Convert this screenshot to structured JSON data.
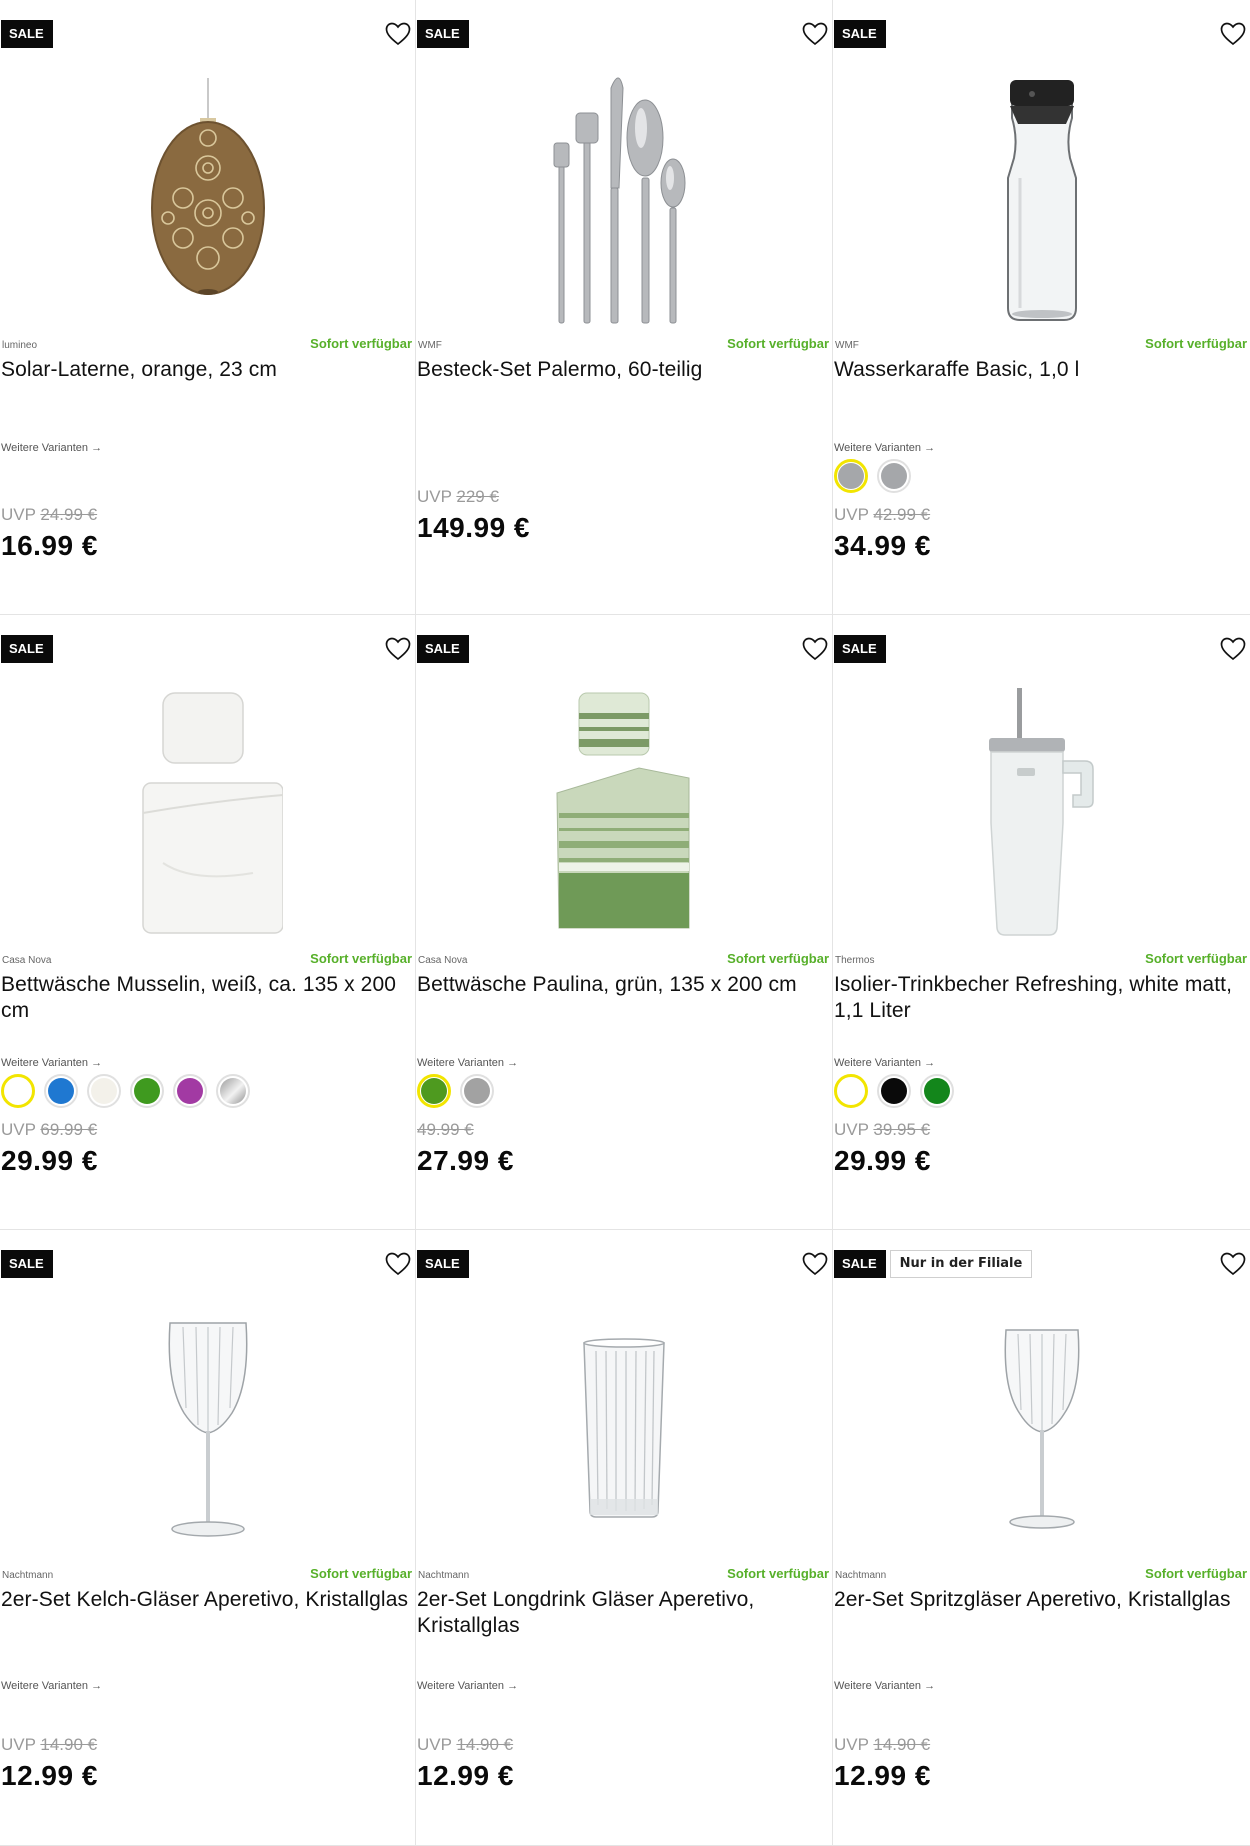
{
  "products": [
    {
      "sale_label": "SALE",
      "extra_badge": "",
      "brand": "lumineo",
      "availability": "Sofort verfügbar",
      "title": "Solar-Laterne, orange, 23 cm",
      "variants_label": "Weitere Varianten →",
      "uvp_label": "UVP",
      "old_price": "24.99 €",
      "price": "16.99 €",
      "swatches": []
    },
    {
      "sale_label": "SALE",
      "extra_badge": "",
      "brand": "WMF",
      "availability": "Sofort verfügbar",
      "title": "Besteck-Set Palermo, 60-teilig",
      "variants_label": "",
      "uvp_label": "UVP",
      "old_price": "229 €",
      "price": "149.99 €",
      "swatches": []
    },
    {
      "sale_label": "SALE",
      "extra_badge": "",
      "brand": "WMF",
      "availability": "Sofort verfügbar",
      "title": "Wasserkaraffe Basic, 1,0 l",
      "variants_label": "Weitere Varianten →",
      "uvp_label": "UVP",
      "old_price": "42.99 €",
      "price": "34.99 €",
      "swatches": [
        {
          "color": "#a5a7aa",
          "selected": true
        },
        {
          "color": "#a5a7aa",
          "selected": false
        }
      ]
    },
    {
      "sale_label": "SALE",
      "extra_badge": "",
      "brand": "Casa Nova",
      "availability": "Sofort verfügbar",
      "title": "Bettwäsche Musselin, weiß, ca. 135 x 200 cm",
      "variants_label": "Weitere Varianten →",
      "uvp_label": "UVP",
      "old_price": "69.99 €",
      "price": "29.99 €",
      "swatches": [
        {
          "color": "#ffffff",
          "selected": true
        },
        {
          "color": "#1f78d1",
          "selected": false
        },
        {
          "color": "#f3f1ea",
          "selected": false
        },
        {
          "color": "#3f9a1f",
          "selected": false
        },
        {
          "color": "#a23aa3",
          "selected": false
        },
        {
          "color": "linear-gradient(135deg,#9a9a9a,#f2f2f2 55%,#8f8f8f)",
          "selected": false
        }
      ]
    },
    {
      "sale_label": "SALE",
      "extra_badge": "",
      "brand": "Casa Nova",
      "availability": "Sofort verfügbar",
      "title": "Bettwäsche Paulina, grün, 135 x 200 cm",
      "variants_label": "Weitere Varianten →",
      "uvp_label": "",
      "old_price": "49.99 €",
      "price": "27.99 €",
      "swatches": [
        {
          "color": "#4e9a1f",
          "selected": true
        },
        {
          "color": "#a2a2a2",
          "selected": false
        }
      ]
    },
    {
      "sale_label": "SALE",
      "extra_badge": "",
      "brand": "Thermos",
      "availability": "Sofort verfügbar",
      "title": "Isolier-Trinkbecher Refreshing, white matt, 1,1 Liter",
      "variants_label": "Weitere Varianten →",
      "uvp_label": "UVP",
      "old_price": "39.95 €",
      "price": "29.99 €",
      "swatches": [
        {
          "color": "#ffffff",
          "selected": true
        },
        {
          "color": "#0a0a0a",
          "selected": false
        },
        {
          "color": "#13861b",
          "selected": false
        }
      ]
    },
    {
      "sale_label": "SALE",
      "extra_badge": "",
      "brand": "Nachtmann",
      "availability": "Sofort verfügbar",
      "title": "2er-Set Kelch-Gläser Aperetivo, Kristallglas",
      "variants_label": "Weitere Varianten →",
      "uvp_label": "UVP",
      "old_price": "14.90 €",
      "price": "12.99 €",
      "swatches": []
    },
    {
      "sale_label": "SALE",
      "extra_badge": "",
      "brand": "Nachtmann",
      "availability": "Sofort verfügbar",
      "title": "2er-Set Longdrink Gläser Aperetivo, Kristallglas",
      "variants_label": "Weitere Varianten →",
      "uvp_label": "UVP",
      "old_price": "14.90 €",
      "price": "12.99 €",
      "swatches": []
    },
    {
      "sale_label": "SALE",
      "extra_badge": "Nur in der Filiale",
      "brand": "Nachtmann",
      "availability": "Sofort verfügbar",
      "title": "2er-Set Spritzgläser Aperetivo, Kristallglas",
      "variants_label": "Weitere Varianten →",
      "uvp_label": "UVP",
      "old_price": "14.90 €",
      "price": "12.99 €",
      "swatches": []
    }
  ],
  "icons": {
    "favorite": "heart-outline-icon"
  },
  "colors": {
    "sale_badge_bg": "#0a0a0a",
    "availability_green": "#57b02a",
    "selected_swatch_ring": "#f2e500"
  }
}
